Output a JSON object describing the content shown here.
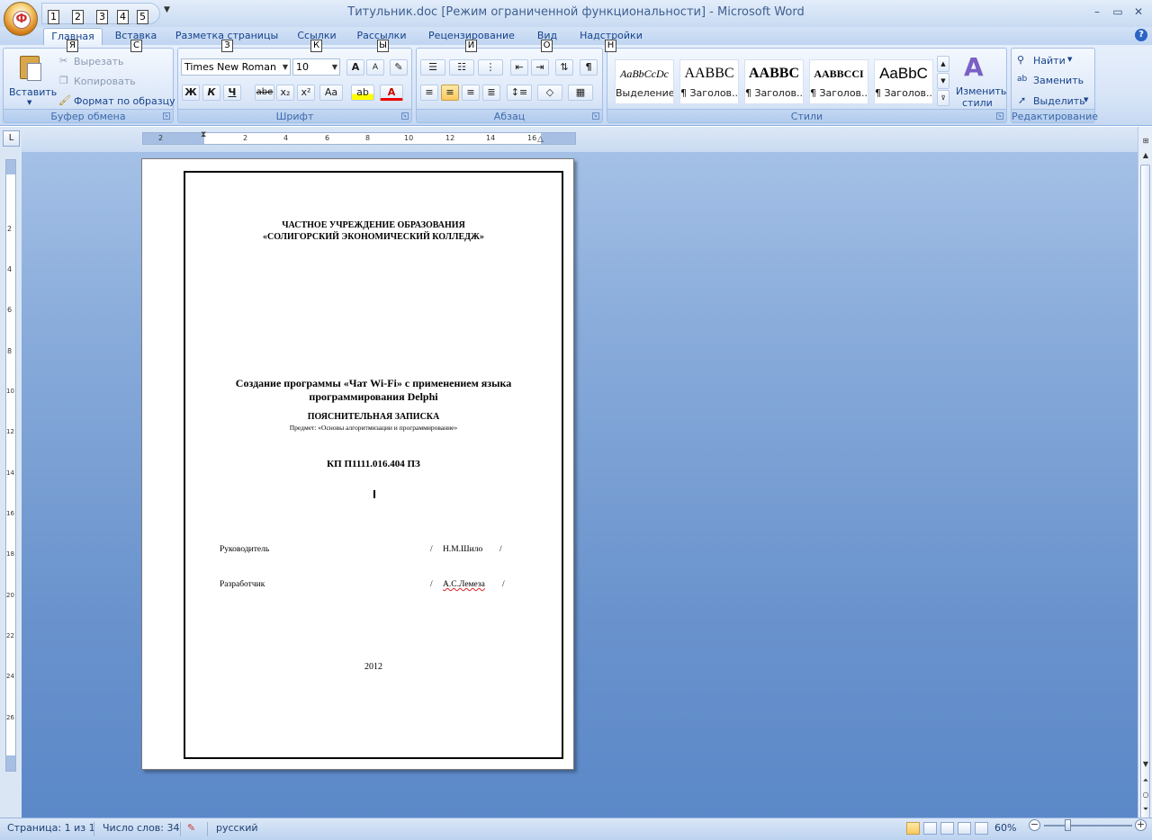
{
  "window": {
    "title": "Титульник.doc [Режим ограниченной функциональности] - Microsoft Word",
    "office_key": "Ф",
    "qat_keys": [
      "1",
      "2",
      "3",
      "4",
      "5"
    ]
  },
  "tabs": [
    {
      "label": "Главная",
      "key": "Я"
    },
    {
      "label": "Вставка",
      "key": "С"
    },
    {
      "label": "Разметка страницы",
      "key": "З"
    },
    {
      "label": "Ссылки",
      "key": "К"
    },
    {
      "label": "Рассылки",
      "key": "Ы"
    },
    {
      "label": "Рецензирование",
      "key": "И"
    },
    {
      "label": "Вид",
      "key": "О"
    },
    {
      "label": "Надстройки",
      "key": "Н"
    }
  ],
  "ribbon": {
    "clipboard": {
      "group": "Буфер обмена",
      "paste": "Вставить",
      "cut": "Вырезать",
      "copy": "Копировать",
      "format_painter": "Формат по образцу"
    },
    "font": {
      "group": "Шрифт",
      "font_name": "Times New Roman",
      "font_size": "10",
      "grow": "A",
      "shrink": "A",
      "bold": "Ж",
      "italic": "К",
      "underline": "Ч",
      "strike": "abe",
      "subscript": "x₂",
      "superscript": "x²",
      "change_case": "Aa"
    },
    "paragraph": {
      "group": "Абзац",
      "pilcrow": "¶"
    },
    "styles": {
      "group": "Стили",
      "items": [
        {
          "preview": "AaBbCcDc",
          "name": "Выделение"
        },
        {
          "preview": "AABBC",
          "name": "¶ Заголов..."
        },
        {
          "preview": "AABBC",
          "name": "¶ Заголов..."
        },
        {
          "preview": "AABBCCI",
          "name": "¶ Заголов..."
        },
        {
          "preview": "AaBbC",
          "name": "¶ Заголов..."
        }
      ],
      "change_styles_line1": "Изменить",
      "change_styles_line2": "стили"
    },
    "editing": {
      "group": "Редактирование",
      "find": "Найти",
      "replace": "Заменить",
      "select": "Выделить"
    }
  },
  "ruler": {
    "horizontal_ticks": [
      "2",
      "2",
      "4",
      "6",
      "8",
      "10",
      "12",
      "14",
      "16"
    ],
    "vertical_ticks": [
      "2",
      "4",
      "6",
      "8",
      "10",
      "12",
      "14",
      "16",
      "18",
      "20",
      "22",
      "24",
      "26"
    ]
  },
  "document": {
    "org_line1": "ЧАСТНОЕ УЧРЕЖДЕНИЕ ОБРАЗОВАНИЯ",
    "org_line2": "«СОЛИГОРСКИЙ   ЭКОНОМИЧЕСКИЙ КОЛЛЕДЖ»",
    "title_line1": "Создание программы «Чат Wi-Fi» с применением языка",
    "title_line2": "программирования Delphi",
    "doc_type": "ПОЯСНИТЕЛЬНАЯ ЗАПИСКА",
    "subject": "Предмет: «Основы алгоритмизации и программирование»",
    "code": "КП П1111.016.404 ПЗ",
    "supervisor_label": "Руководитель",
    "supervisor_name": "Н.М.Шило",
    "developer_label": "Разработчик",
    "developer_name": "А.С.Лемеза",
    "slash": "/",
    "year": "2012"
  },
  "status_bar": {
    "page": "Страница: 1 из 1",
    "words": "Число слов: 34",
    "language": "русский",
    "zoom": "60%"
  }
}
